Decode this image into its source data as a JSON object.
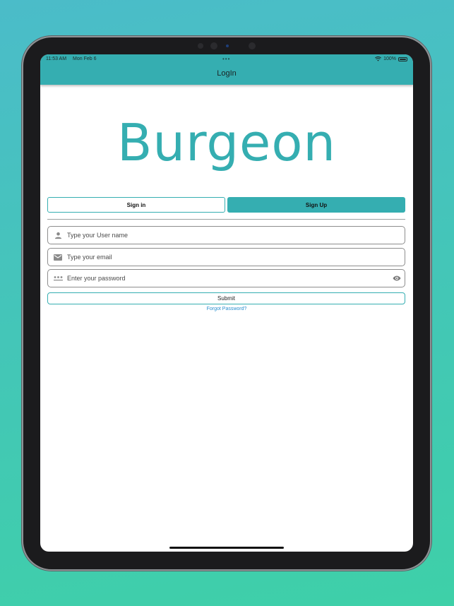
{
  "status_bar": {
    "time": "11:53 AM",
    "date": "Mon Feb 6",
    "multitask_dots": "•••",
    "battery": "100%"
  },
  "app_bar": {
    "title": "LogIn"
  },
  "logo": {
    "text": "Burgeon"
  },
  "tabs": [
    {
      "label": "Sign in",
      "selected": false
    },
    {
      "label": "Sign Up",
      "selected": true
    }
  ],
  "fields": {
    "username": {
      "placeholder": "Type your User name",
      "icon": "person-icon"
    },
    "email": {
      "placeholder": "Type your email",
      "icon": "mail-icon"
    },
    "password": {
      "placeholder": "Enter your password",
      "icon": "password-dots-icon",
      "trailing_icon": "eye-icon"
    }
  },
  "submit_label": "Submit",
  "forgot_label": "Forgot Password?",
  "colors": {
    "accent": "#35aeb1",
    "link": "#2a8fcf",
    "background_top": "#4bbcc9",
    "background_bottom": "#3ed0a8"
  }
}
